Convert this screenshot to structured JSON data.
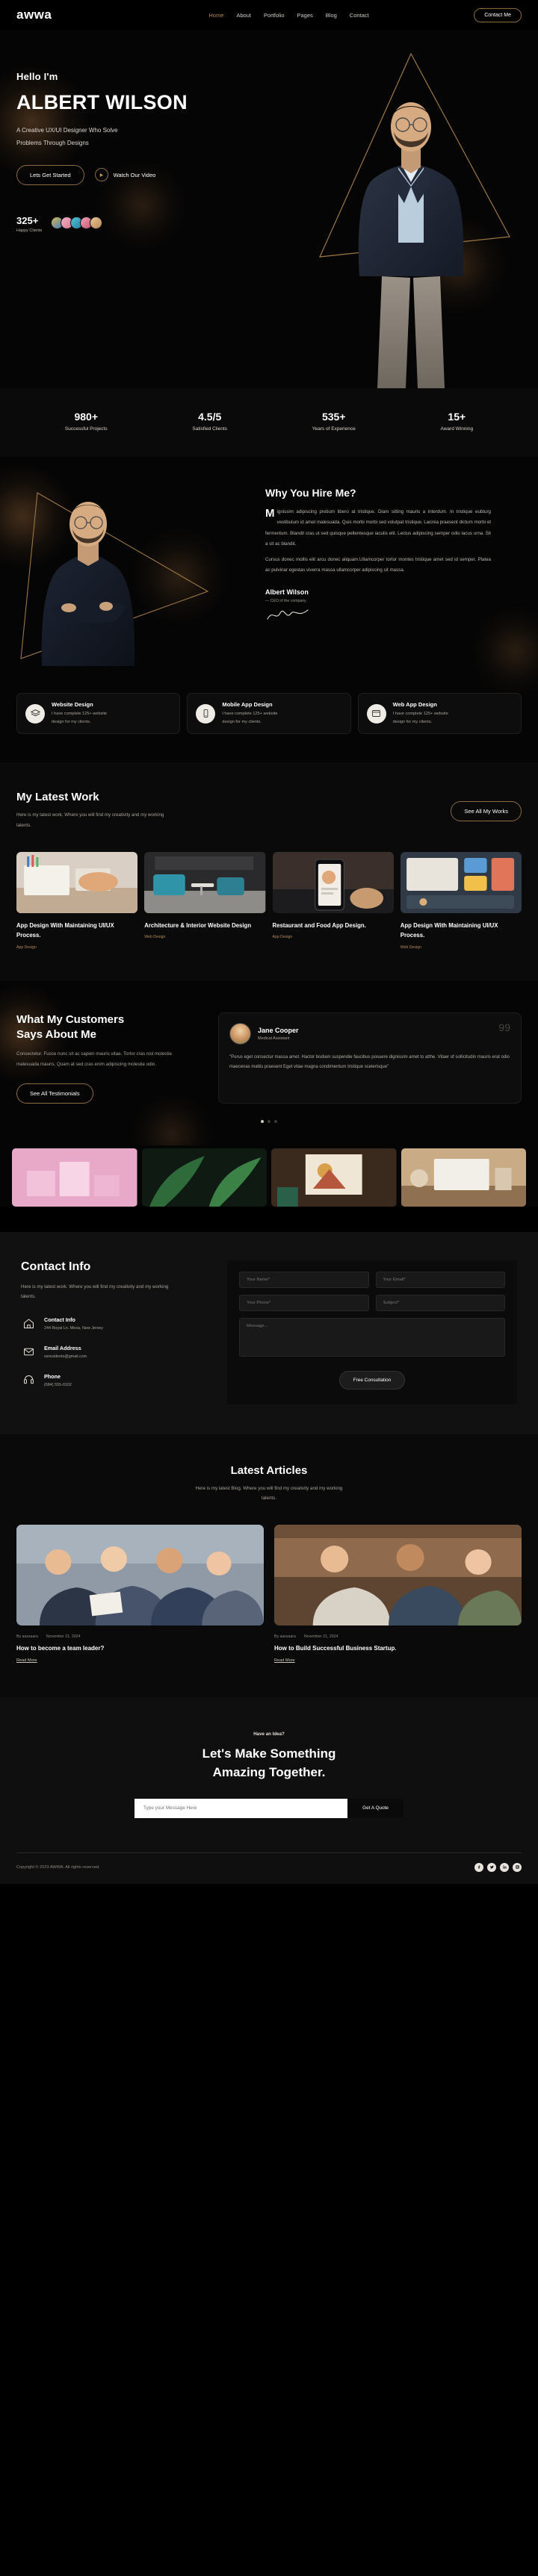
{
  "header": {
    "logo": "awwa",
    "nav": [
      {
        "label": "Home",
        "active": true
      },
      {
        "label": "About",
        "active": false
      },
      {
        "label": "Portfolio",
        "active": false
      },
      {
        "label": "Pages",
        "active": false
      },
      {
        "label": "Blog",
        "active": false
      },
      {
        "label": "Contact",
        "active": false
      }
    ],
    "cta_label": "Contact Me"
  },
  "hero": {
    "greeting": "Hello I'm",
    "name": "ALBERT WILSON",
    "subtitle_line1": "A Creative UX/UI Designer Who Solve",
    "subtitle_line2": "Problems Through Designs",
    "primary_button": "Lets Get Started",
    "video_button": "Watch Our Video",
    "clients_count": "325+",
    "clients_label": "Happy Clients"
  },
  "stats": [
    {
      "value": "980+",
      "label": "Successful Projects"
    },
    {
      "value": "4.5/5",
      "label": "Satisfied Clients"
    },
    {
      "value": "535+",
      "label": "Years of Experience"
    },
    {
      "value": "15+",
      "label": "Award Winning"
    }
  ],
  "why": {
    "title": "Why You Hire Me?",
    "dropcap": "M",
    "para1": "ignissim adipiscing pretium libero at tristique. Diam sitting mauris a interdum. In tristique eubturg vestibulum id amet malesuada. Quis morbi morbi sed volutpat tristique. Lacinia praesent dictum morbi et fermentum. Blandit cras ut sed quisque pellentesque iaculis elit. Lectus adipiscing semper odio lacus urna. Sit a sit ac blandit.",
    "para2": "Cursus donec mollis elit arcu donec aliquam.Ullamcorper tortor montes tristique amet sed id semper. Platea ac pulvinar egestas viverra massa ullamcorper adipiscing sit massa.",
    "signer_name": "Albert Wilson",
    "signer_role": "— CEO of the company"
  },
  "services": [
    {
      "icon": "layers-icon",
      "title": "Website Design",
      "desc_line1": "I have complete 125+ website",
      "desc_line2": "design for my clients."
    },
    {
      "icon": "mobile-icon",
      "title": "Mobile App Design",
      "desc_line1": "I have complete 125+ website",
      "desc_line2": "design for my clients."
    },
    {
      "icon": "browser-icon",
      "title": "Web App Design",
      "desc_line1": "I have complete 125+ website",
      "desc_line2": "design for my clients."
    }
  ],
  "work": {
    "title": "My Latest Work",
    "subtitle": "Here is my latest work. Where you will find my creativity and my working talents.",
    "cta_label": "See All My Works",
    "cards": [
      {
        "title": "App Design With Maintaining UI/UX Process.",
        "tag": "App Design"
      },
      {
        "title": "Architecture & Interior Website Design",
        "tag": "Web Design"
      },
      {
        "title": "Restaurant and Food App Design.",
        "tag": "App Design"
      },
      {
        "title": "App Design With Maintaining UI/UX Process.",
        "tag": "Web Design"
      }
    ]
  },
  "testimonials": {
    "title_line1": "What My Customers",
    "title_line2": "Says About Me",
    "subtitle": "Consectetur. Fusce nunc sit ac sapien mauris vitae. Tortor cras nisl molestie malesuada mauris. Quam at sed cras enim adipiscing molestie odio.",
    "cta_label": "See All Testimonials",
    "card": {
      "name": "Jane Cooper",
      "role": "Medical Assistant",
      "quote_mark": "99",
      "text": "\"Purus eget consectur massa amet. Hactor bodiam suspendie faucibus posuere dignissim amet to atthe. Vitaer of sollicitudin mauris erat odio maecenas mattis praesent Eget vitae magna condimentum tristique scelerisque\""
    },
    "dot_count": 3,
    "active_dot": 0
  },
  "contact": {
    "title": "Contact Info",
    "subtitle": "Here is my latest work. Where you will find my creativity and my working talents.",
    "items": [
      {
        "icon": "home-icon",
        "title": "Contact Info",
        "value": "244 Royal Ln. Mesa, New Jersey"
      },
      {
        "icon": "mail-icon",
        "title": "Email Address",
        "value": "ssresidents@gmail.com"
      },
      {
        "icon": "phone-icon",
        "title": "Phone",
        "value": "(684) 555-0102"
      }
    ],
    "form": {
      "name_placeholder": "Your Name*",
      "email_placeholder": "Your Email*",
      "phone_placeholder": "Your Phone*",
      "subject_placeholder": "Subject*",
      "message_placeholder": "Message...",
      "submit_label": "Free Consultation"
    }
  },
  "articles": {
    "title": "Latest Articles",
    "subtitle": "Here is my latest Blog. Where you will find my creativity and my working talents.",
    "cards": [
      {
        "author": "By aassaara",
        "date": "November 21, 2024",
        "title": "How to become a team leader?",
        "more": "Read More"
      },
      {
        "author": "By aassaara",
        "date": "November 21, 2024",
        "title": "How to Build Successful Business Startup.",
        "more": "Read More"
      }
    ]
  },
  "cta": {
    "eyebrow": "Have an Idea?",
    "title_line1": "Let's Make Something",
    "title_line2": "Amazing Together.",
    "input_placeholder": "Type your Message Here",
    "button_label": "Get A Quote"
  },
  "footer": {
    "copyright": "Copyright © 2023 AWWA. All rights reserved.",
    "socials": [
      "facebook-icon",
      "twitter-icon",
      "linkedin-icon",
      "instagram-icon"
    ]
  },
  "colors": {
    "accent": "#b5895a",
    "border_gold": "#8c6a42",
    "bg": "#000000",
    "panel": "#0d0d0d"
  }
}
